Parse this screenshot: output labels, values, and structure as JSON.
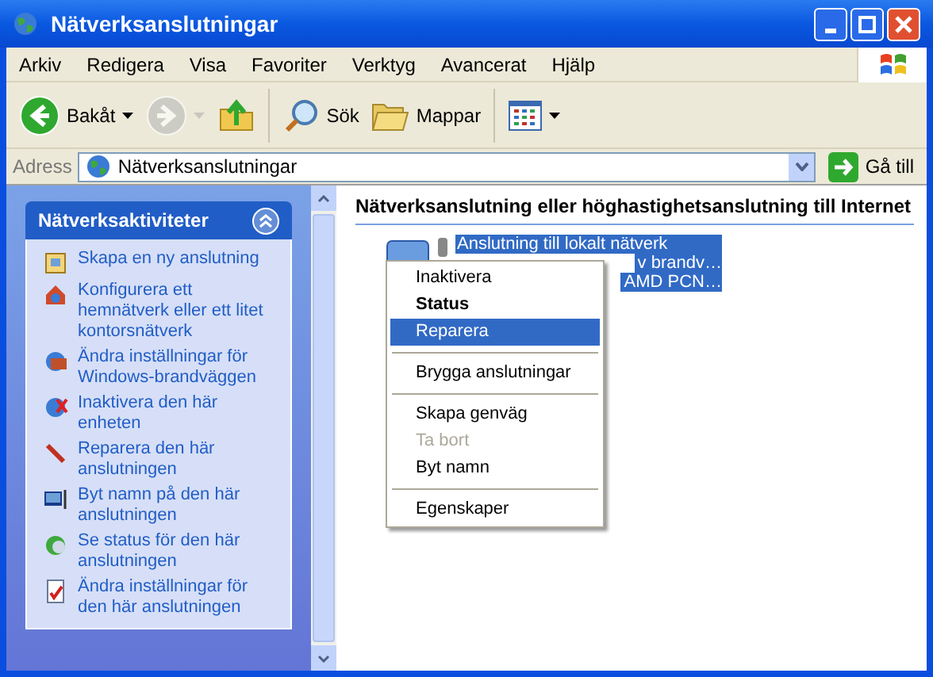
{
  "window": {
    "title": "Nätverksanslutningar"
  },
  "menu_bar": [
    "Arkiv",
    "Redigera",
    "Visa",
    "Favoriter",
    "Verktyg",
    "Avancerat",
    "Hjälp"
  ],
  "toolbar": [
    {
      "kind": "back",
      "label": "Bakåt",
      "disabled": false
    },
    {
      "kind": "forward",
      "disabled": true
    },
    {
      "kind": "up",
      "disabled": false
    },
    {
      "kind": "search",
      "label": "Sök",
      "disabled": false
    },
    {
      "kind": "folders",
      "label": "Mappar",
      "disabled": false
    },
    {
      "kind": "views",
      "disabled": false
    }
  ],
  "address_bar": {
    "label": "Adress",
    "value": "Nätverksanslutningar",
    "go": "Gå till"
  },
  "task_pane": {
    "title": "Nätverksaktiviteter",
    "expanded": true,
    "items": [
      {
        "kind": "new",
        "label": "Skapa en ny anslutning"
      },
      {
        "kind": "home",
        "label": "Konfigurera ett hemnätverk eller ett litet kontorsnätverk"
      },
      {
        "kind": "firewall",
        "label": "Ändra inställningar för Windows-brandväggen"
      },
      {
        "kind": "disable",
        "label": "Inaktivera den här enheten"
      },
      {
        "kind": "repair",
        "label": "Reparera den här anslutningen"
      },
      {
        "kind": "rename",
        "label": "Byt namn på den här anslutningen"
      },
      {
        "kind": "status",
        "label": "Se status för den här anslutningen"
      },
      {
        "kind": "settings",
        "label": "Ändra inställningar för den här anslutningen"
      }
    ]
  },
  "content": {
    "group_title": "Nätverksanslutning eller höghastighetsanslutning till Internet",
    "connection": {
      "selected": true,
      "name": "Anslutning till lokalt nätverk",
      "line_2": "v brandv…",
      "line_3": "AMD PCN…"
    }
  },
  "context_menu": [
    {
      "kind": "item",
      "label": "Inaktivera",
      "default": false,
      "disabled": false,
      "selected": false
    },
    {
      "kind": "item",
      "label": "Status",
      "default": true,
      "disabled": false,
      "selected": false
    },
    {
      "kind": "item",
      "label": "Reparera",
      "default": false,
      "disabled": false,
      "selected": true
    },
    {
      "kind": "separator"
    },
    {
      "kind": "item",
      "label": "Brygga anslutningar",
      "default": false,
      "disabled": false,
      "selected": false
    },
    {
      "kind": "separator"
    },
    {
      "kind": "item",
      "label": "Skapa genväg",
      "default": false,
      "disabled": false,
      "selected": false
    },
    {
      "kind": "item",
      "label": "Ta bort",
      "default": false,
      "disabled": true,
      "selected": false
    },
    {
      "kind": "item",
      "label": "Byt namn",
      "default": false,
      "disabled": false,
      "selected": false
    },
    {
      "kind": "separator"
    },
    {
      "kind": "item",
      "label": "Egenskaper",
      "default": false,
      "disabled": false,
      "selected": false
    }
  ]
}
